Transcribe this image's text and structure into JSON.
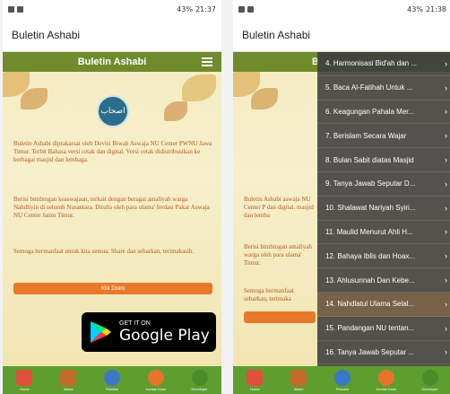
{
  "left": {
    "status": {
      "time": "21:37",
      "battery": "43%"
    },
    "appbar_title": "Buletin Ashabi",
    "banner_title": "Buletin Ashabi",
    "paragraphs": [
      "Buletin Ashabi diprakarsai oleh Devisi Biwah Aswaja NU Center PWNU Jawa Timur. Terbit Bahasa versi cetak dan digital. Versi cetak didistribusikan ke berbagai masjid dan lembaga.",
      "Berisi bimbingan keaswajaan, terkait dengan beragai amaliyah warga Nahdliyin di seluruh Nusantara. Ditulis oleh para ulama' ferdasi Pakar Aswaja NU Center Jatim Timur.",
      "Semoga bermanfaat untuk kita semua. Share dan sebarkan, terimakasih."
    ],
    "cta_label": "Klik Disini",
    "gplay": {
      "small": "GET IT ON",
      "big": "Google Play"
    },
    "nav": [
      {
        "label": "Home",
        "color": "#e0503a"
      },
      {
        "label": "Ilstore",
        "color": "#c46b2a"
      },
      {
        "label": "Penulisi",
        "color": "#3b78c4"
      },
      {
        "label": "Kontak Kami",
        "color": "#e8742a"
      },
      {
        "label": "Developer",
        "color": "#4a8c2a"
      }
    ]
  },
  "right": {
    "status": {
      "time": "21:38",
      "battery": "43%"
    },
    "appbar_title": "Buletin Ashabi",
    "banner_title": "B",
    "drawer_items": [
      {
        "label": "4. Harmonisasi Bid'ah dan ..."
      },
      {
        "label": "5. Baca Al-Fatihah Untuk ..."
      },
      {
        "label": "6. Keagungan Pahala Mer..."
      },
      {
        "label": "7. Berislam Secara Wajar"
      },
      {
        "label": "8. Bulan Sabit diatas Masjid"
      },
      {
        "label": "9. Tanya Jawab Seputar D..."
      },
      {
        "label": "10. Shalawat Nariyah Syiri..."
      },
      {
        "label": "11. Maulid Menurut Ahli H..."
      },
      {
        "label": "12. Bahaya Iblis dan Hoax..."
      },
      {
        "label": "13. Ahlusunnah Dan Kebe..."
      },
      {
        "label": "14. Nahdlatul Ulama Selal..."
      },
      {
        "label": "15. Pandangan NU tentan..."
      },
      {
        "label": "16. Tanya Jawab Seputar ..."
      }
    ],
    "active_index": 10,
    "partial_paragraphs": [
      "Buletin Ashabi aswaja NU Center P dan digital. masjid dan lemba",
      "Berisi bimbingan amaliyah warga oleh para ulama' Timur.",
      "Semoga bermanfaat sebarkan, terimaka"
    ],
    "nav": [
      {
        "label": "Home",
        "color": "#e0503a"
      },
      {
        "label": "Ilstore",
        "color": "#c46b2a"
      },
      {
        "label": "Penulisi",
        "color": "#3b78c4"
      },
      {
        "label": "Kontak Kami",
        "color": "#e8742a"
      },
      {
        "label": "Developer",
        "color": "#4a8c2a"
      }
    ]
  }
}
